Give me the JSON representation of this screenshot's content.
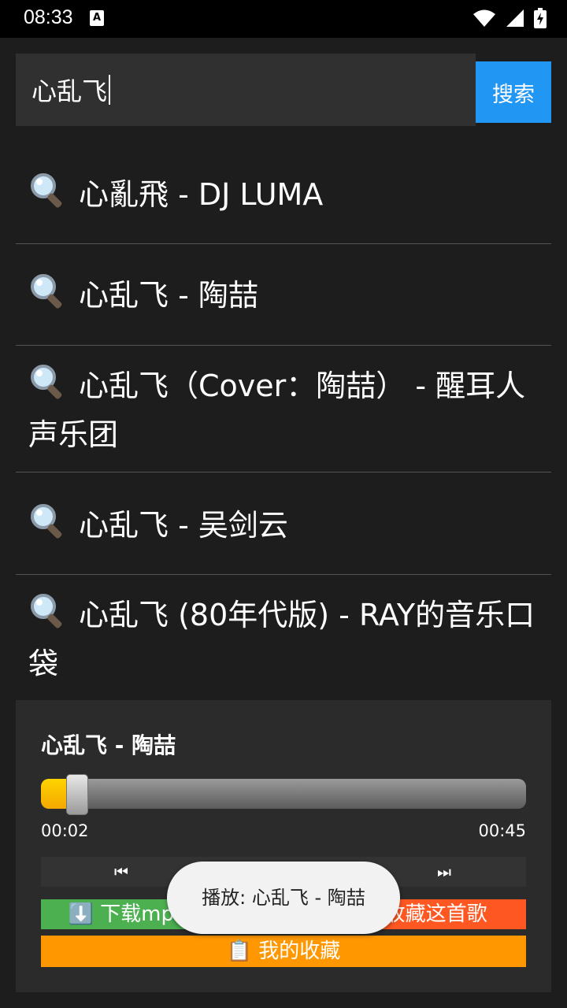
{
  "status_bar": {
    "time": "08:33",
    "a_badge": "A"
  },
  "search": {
    "value": "心乱飞",
    "button_label": "搜索"
  },
  "results": [
    {
      "text": "心亂飛 - DJ LUMA"
    },
    {
      "text": "心乱飞 - 陶喆"
    },
    {
      "text": "心乱飞（Cover：陶喆） - 醒耳人声乐团"
    },
    {
      "text": "心乱飞 - 吴剑云"
    },
    {
      "text": "心乱飞 (80年代版) - RAY的音乐口袋"
    }
  ],
  "player": {
    "title": "心乱飞 - 陶喆",
    "current_time": "00:02",
    "total_time": "00:45",
    "progress_fraction": 0.044,
    "prev_label": "⏮",
    "next_label": "⏭",
    "download_label": "⬇️ 下载mp3",
    "favorite_label": "⭐ 收藏这首歌",
    "my_favorites_label": "📋 我的收藏"
  },
  "toast": {
    "text": "播放: 心乱飞 - 陶喆"
  },
  "colors": {
    "accent_blue": "#2196f3",
    "download_green": "#4caf50",
    "favorite_red": "#ff5722",
    "my_favorites_orange": "#ff9800",
    "progress_yellow": "#ffd400"
  }
}
